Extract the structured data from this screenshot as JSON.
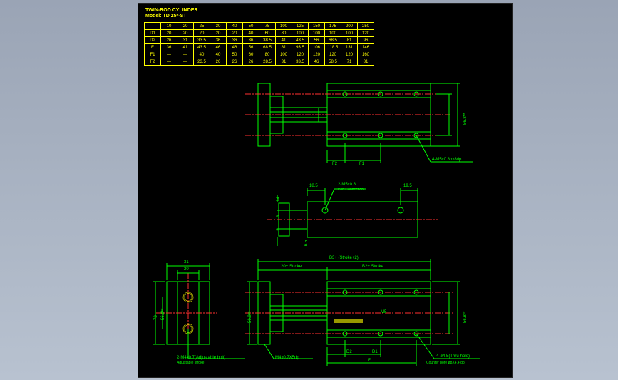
{
  "title_line1": "TWIN-ROD CYLINDER",
  "title_line2": "Model: TD 25*-ST",
  "table": {
    "headers": [
      "",
      "10",
      "20",
      "25",
      "30",
      "40",
      "50",
      "75",
      "100",
      "125",
      "150",
      "175",
      "200",
      "250"
    ],
    "rows": [
      {
        "k": "D1",
        "v": [
          "20",
          "20",
          "20",
          "20",
          "20",
          "40",
          "60",
          "80",
          "100",
          "100",
          "100",
          "100",
          "120"
        ]
      },
      {
        "k": "D2",
        "v": [
          "26",
          "31",
          "33.5",
          "36",
          "36",
          "36",
          "38.5",
          "41",
          "43.5",
          "56",
          "68.5",
          "81",
          "96"
        ]
      },
      {
        "k": "E",
        "v": [
          "36",
          "41",
          "43.5",
          "46",
          "46",
          "56",
          "68.5",
          "81",
          "93.5",
          "106",
          "118.5",
          "131",
          "146"
        ]
      },
      {
        "k": "F1",
        "v": [
          "—",
          "—",
          "40",
          "40",
          "50",
          "60",
          "80",
          "100",
          "120",
          "120",
          "120",
          "120",
          "160"
        ]
      },
      {
        "k": "F2",
        "v": [
          "—",
          "—",
          "23.5",
          "26",
          "26",
          "26",
          "28.5",
          "31",
          "33.5",
          "46",
          "58.5",
          "71",
          "81"
        ]
      }
    ]
  },
  "dims": {
    "d_568": "56.8**",
    "F2": "F2",
    "F1": "F1",
    "tap_m5": "4-M5x0.8px8dp",
    "d_185": "18.5",
    "port": "2-M5x0.8",
    "port_sub": "Port Connection",
    "d_195": "19.5",
    "d_14": "14",
    "d_6": "6",
    "d_15": "15",
    "d_65": "6.5",
    "d_31": "31",
    "d_20": "20",
    "d_73": "73",
    "d_568l": "56.8**",
    "adj_bolt": "2-M4x0.7(Adjustable bolt)",
    "adj_sub": "Adjustable stroke",
    "B3": "B3+ (Stroke+2)",
    "B2": "B2+ Stroke",
    "B1": "20+ Stroke",
    "d_568r": "56.8**",
    "d_568c": "56.8**",
    "m4tap": "M4x0.7X5dp",
    "thru": "4-ø4.5(Thru-hole)",
    "cbore": "Counter bore ø8X4.4 dp",
    "D2": "D2",
    "D1": "D1",
    "E": "E",
    "M5": "M5"
  },
  "chart_data": {
    "type": "table",
    "title": "TWIN-ROD CYLINDER TD 25*-ST stroke-dependent dimensions",
    "categories": [
      "10",
      "20",
      "25",
      "30",
      "40",
      "50",
      "75",
      "100",
      "125",
      "150",
      "175",
      "200",
      "250"
    ],
    "series": [
      {
        "name": "D1",
        "values": [
          20,
          20,
          20,
          20,
          20,
          40,
          60,
          80,
          100,
          100,
          100,
          100,
          120
        ]
      },
      {
        "name": "D2",
        "values": [
          26,
          31,
          33.5,
          36,
          36,
          36,
          38.5,
          41,
          43.5,
          56,
          68.5,
          81,
          96
        ]
      },
      {
        "name": "E",
        "values": [
          36,
          41,
          43.5,
          46,
          46,
          56,
          68.5,
          81,
          93.5,
          106,
          118.5,
          131,
          146
        ]
      },
      {
        "name": "F1",
        "values": [
          null,
          null,
          40,
          40,
          50,
          60,
          80,
          100,
          120,
          120,
          120,
          120,
          160
        ]
      },
      {
        "name": "F2",
        "values": [
          null,
          null,
          23.5,
          26,
          26,
          26,
          28.5,
          31,
          33.5,
          46,
          58.5,
          71,
          81
        ]
      }
    ]
  }
}
